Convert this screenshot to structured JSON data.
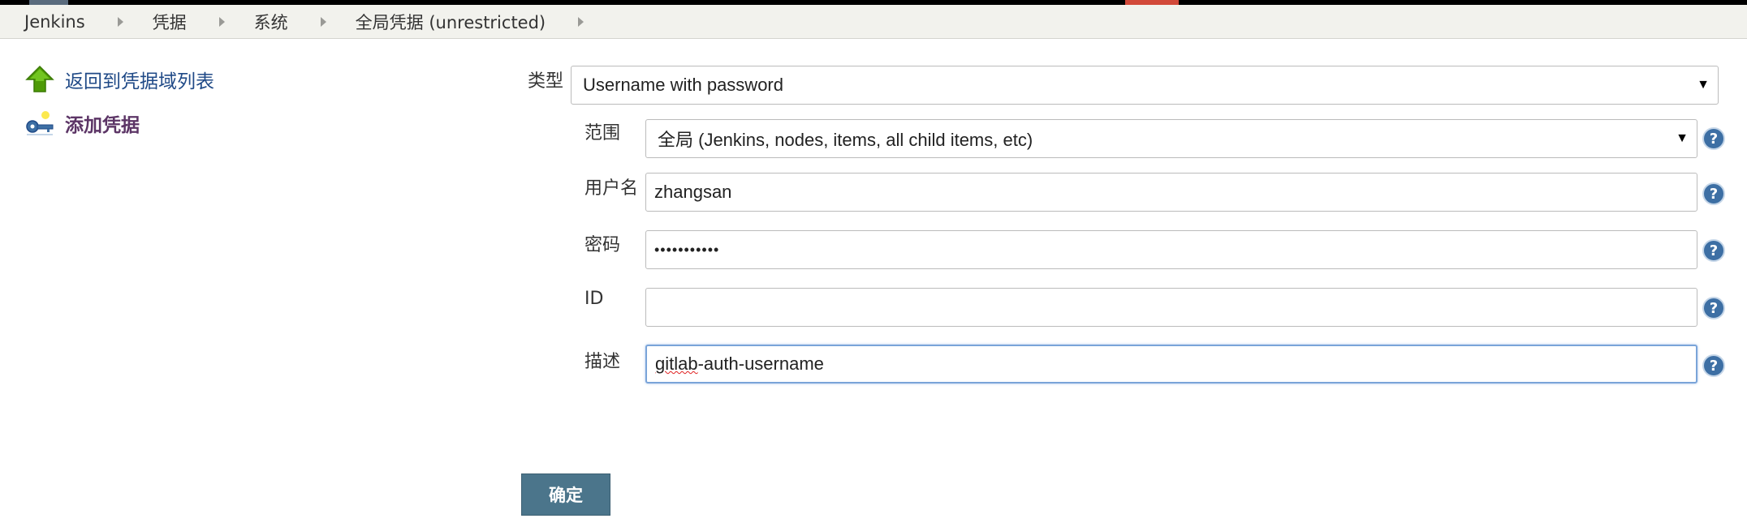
{
  "breadcrumbs": [
    {
      "label": "Jenkins"
    },
    {
      "label": "凭据"
    },
    {
      "label": "系统"
    },
    {
      "label": "全局凭据 (unrestricted)"
    }
  ],
  "side_panel": {
    "back_link": "返回到凭据域列表",
    "add_link": "添加凭据",
    "back_icon": "up-arrow-icon",
    "add_icon": "key-icon"
  },
  "form": {
    "kind": {
      "label": "类型",
      "value": "Username with password"
    },
    "scope": {
      "label": "范围",
      "value": "全局 (Jenkins, nodes, items, all child items, etc)"
    },
    "username": {
      "label": "用户名",
      "value": "zhangsan"
    },
    "password": {
      "label": "密码",
      "value": "•••••••••••"
    },
    "id": {
      "label": "ID",
      "value": ""
    },
    "description": {
      "label": "描述",
      "value_spell": "gitlab",
      "value_rest": "-auth-username"
    },
    "help_glyph": "?",
    "select_arrow": "▼"
  },
  "submit_button": "确定",
  "colors": {
    "link": "#204a87",
    "active_link": "#5c3566",
    "button": "#4b758b",
    "help": "#3d6fa4",
    "focus_border": "#7aa4d9"
  }
}
